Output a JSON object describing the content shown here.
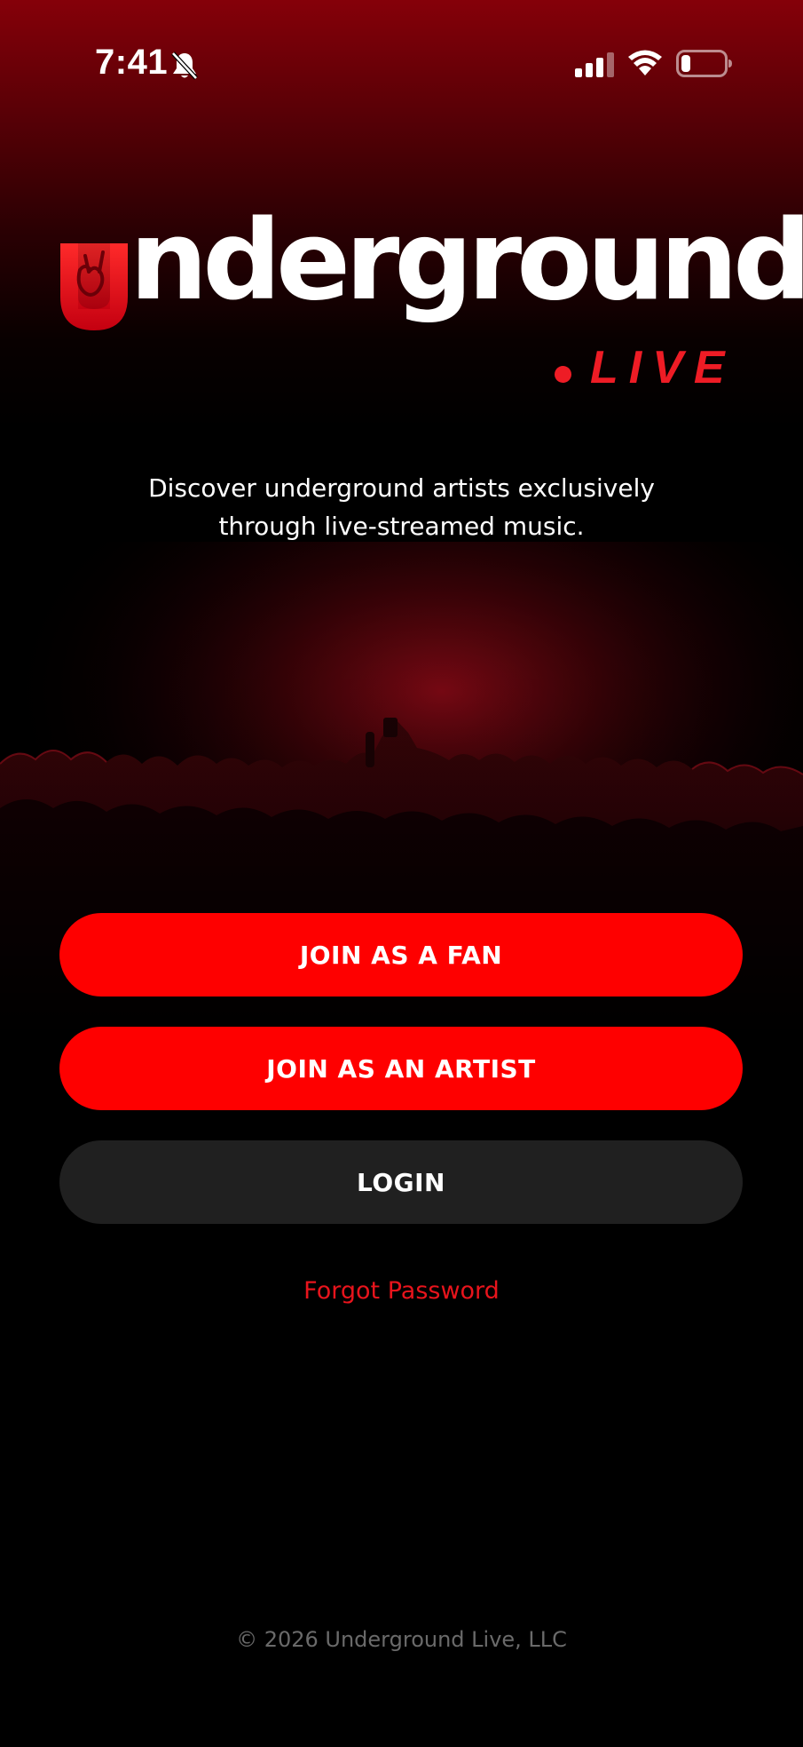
{
  "status_bar": {
    "time": "7:41",
    "icons": [
      "bell-slash-icon",
      "cellular-signal-icon",
      "wifi-icon",
      "battery-low-icon"
    ]
  },
  "logo": {
    "wordmark": "nderground",
    "tagline_word": "LIVE",
    "brand_red": "#ee1c25"
  },
  "tagline": {
    "line1": "Discover underground artists exclusively",
    "line2": "through live-streamed music."
  },
  "buttons": {
    "join_fan": "JOIN AS A FAN",
    "join_artist": "JOIN AS AN ARTIST",
    "login": "LOGIN"
  },
  "links": {
    "forgot_password": "Forgot Password"
  },
  "footer": {
    "copyright": "© 2026 Underground Live, LLC"
  },
  "colors": {
    "primary_button": "#fe0000",
    "secondary_button": "#202020",
    "link": "#e8141c",
    "footer_text": "#6a6a6a",
    "background": "#000000"
  }
}
